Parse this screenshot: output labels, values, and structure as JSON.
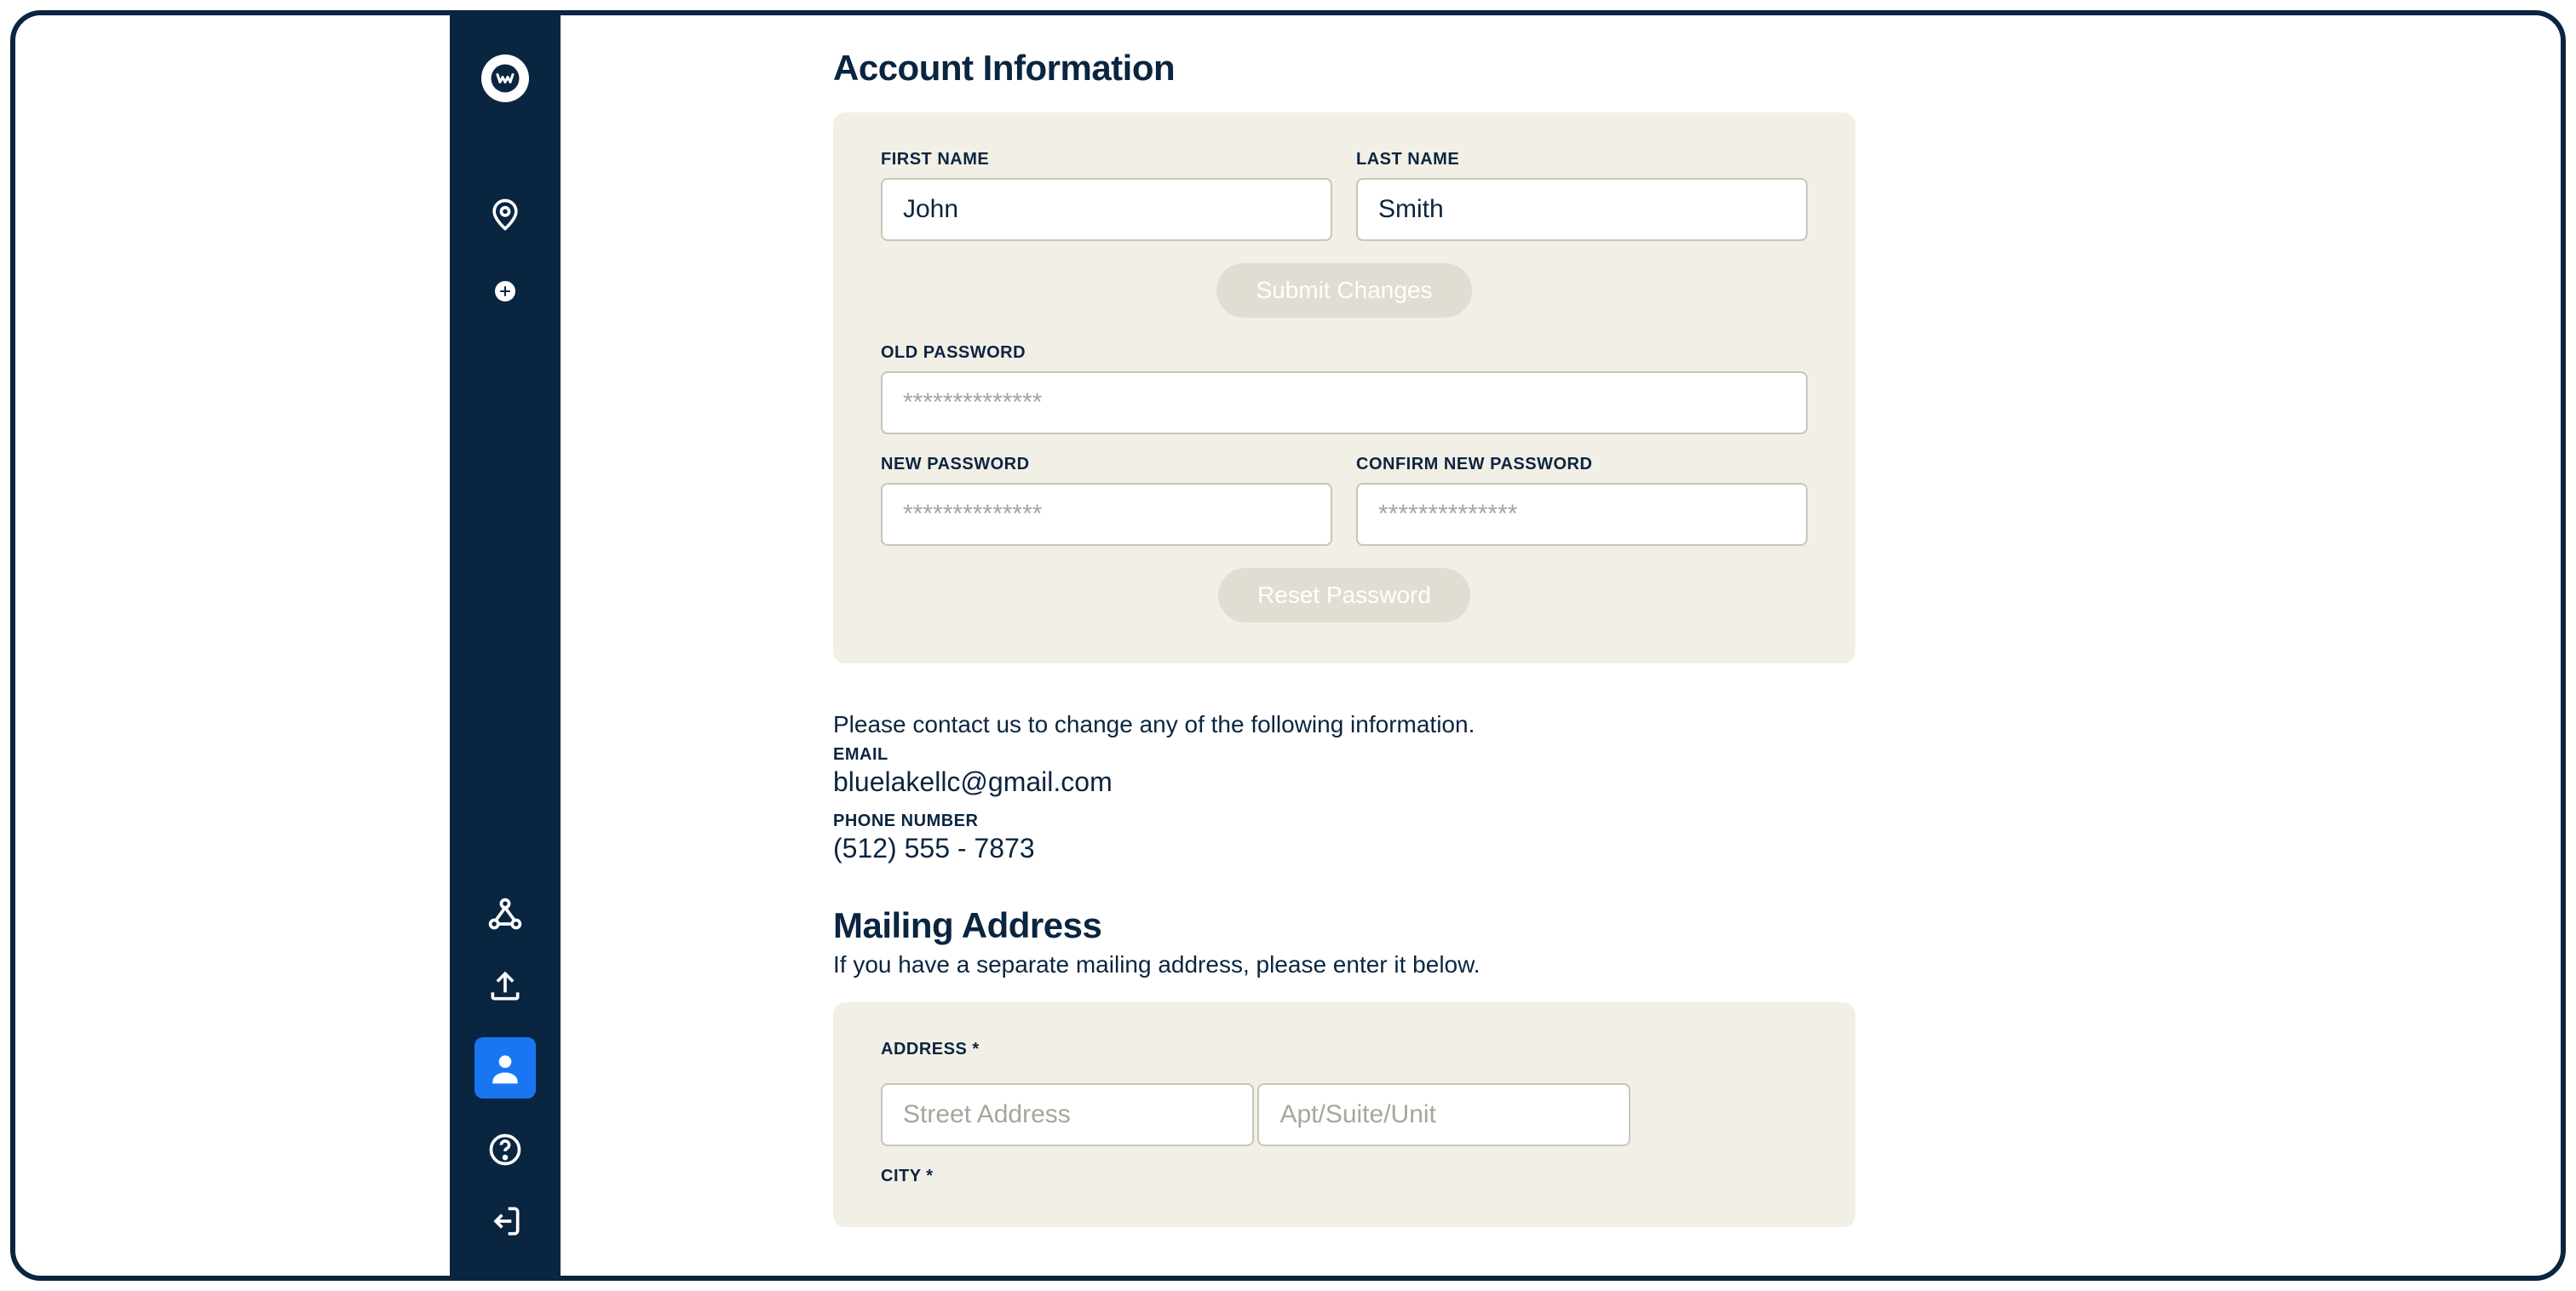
{
  "header": {
    "title": "Account Information"
  },
  "account": {
    "labels": {
      "first_name": "FIRST NAME",
      "last_name": "LAST NAME",
      "old_password": "OLD PASSWORD",
      "new_password": "NEW PASSWORD",
      "confirm_password": "CONFIRM NEW PASSWORD"
    },
    "values": {
      "first_name": "John",
      "last_name": "Smith"
    },
    "placeholders": {
      "password": "**************"
    },
    "buttons": {
      "submit_changes": "Submit Changes",
      "reset_password": "Reset Password"
    }
  },
  "contact": {
    "note": "Please contact us to change any of the following information.",
    "email_label": "EMAIL",
    "email_value": "bluelakellc@gmail.com",
    "phone_label": "PHONE NUMBER",
    "phone_value": "(512) 555 - 7873"
  },
  "mailing": {
    "title": "Mailing Address",
    "subtitle": "If you have a separate mailing address, please enter it below.",
    "labels": {
      "address": "ADDRESS *",
      "city": "CITY *"
    },
    "placeholders": {
      "street": "Street Address",
      "apt": "Apt/Suite/Unit"
    }
  },
  "sidebar": {
    "icons": {
      "logo": "logo",
      "location": "location",
      "add": "add",
      "share_nodes": "share-nodes",
      "upload": "upload",
      "profile": "profile",
      "help": "help",
      "logout": "logout"
    }
  }
}
